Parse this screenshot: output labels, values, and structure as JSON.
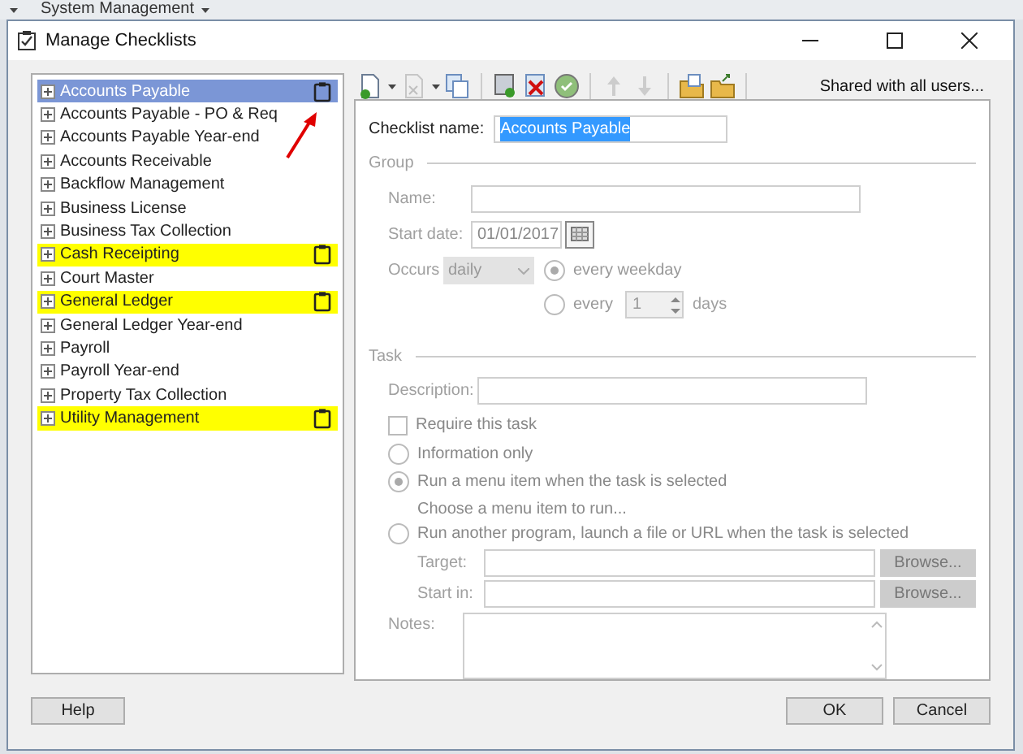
{
  "app_bar": {
    "title": "System Management"
  },
  "window": {
    "title": "Manage Checklists"
  },
  "tree": {
    "items": [
      {
        "label": "Accounts Payable",
        "selected": true,
        "highlighted": false,
        "has_checklist": true
      },
      {
        "label": "Accounts Payable - PO & Req",
        "selected": false,
        "highlighted": false,
        "has_checklist": false
      },
      {
        "label": "Accounts Payable Year-end",
        "selected": false,
        "highlighted": false,
        "has_checklist": false
      },
      {
        "label": "Accounts Receivable",
        "selected": false,
        "highlighted": false,
        "has_checklist": false
      },
      {
        "label": "Backflow Management",
        "selected": false,
        "highlighted": false,
        "has_checklist": false
      },
      {
        "label": "Business License",
        "selected": false,
        "highlighted": false,
        "has_checklist": false
      },
      {
        "label": "Business Tax Collection",
        "selected": false,
        "highlighted": false,
        "has_checklist": false
      },
      {
        "label": "Cash Receipting",
        "selected": false,
        "highlighted": true,
        "has_checklist": true
      },
      {
        "label": "Court Master",
        "selected": false,
        "highlighted": false,
        "has_checklist": false
      },
      {
        "label": "General Ledger",
        "selected": false,
        "highlighted": true,
        "has_checklist": true
      },
      {
        "label": "General Ledger Year-end",
        "selected": false,
        "highlighted": false,
        "has_checklist": false
      },
      {
        "label": "Payroll",
        "selected": false,
        "highlighted": false,
        "has_checklist": false
      },
      {
        "label": "Payroll Year-end",
        "selected": false,
        "highlighted": false,
        "has_checklist": false
      },
      {
        "label": "Property Tax Collection",
        "selected": false,
        "highlighted": false,
        "has_checklist": false
      },
      {
        "label": "Utility Management",
        "selected": false,
        "highlighted": true,
        "has_checklist": true
      }
    ]
  },
  "toolbar": {
    "shared_link": "Shared with all users..."
  },
  "checklist_name": {
    "label": "Checklist name:",
    "value": "Accounts Payable"
  },
  "group": {
    "title": "Group",
    "name_label": "Name:",
    "start_date_label": "Start date:",
    "start_date": "01/01/2017",
    "occurs_label": "Occurs",
    "occurs": "daily",
    "options": [
      {
        "label": "every weekday",
        "selected": true
      },
      {
        "label": "every",
        "selected": false,
        "value": "1",
        "unit": "days"
      }
    ]
  },
  "task": {
    "title": "Task",
    "description_label": "Description:",
    "require": {
      "label": "Require this task",
      "checked": false
    },
    "options": [
      {
        "label": "Information only",
        "selected": false
      },
      {
        "label": "Run a menu item when the task is selected",
        "selected": true,
        "hint": "Choose a menu item to run..."
      },
      {
        "label": "Run another program, launch a file or URL when the task is selected",
        "selected": false
      }
    ],
    "target_label": "Target:",
    "start_in_label": "Start in:",
    "browse": [
      "Browse...",
      "Browse..."
    ],
    "notes_label": "Notes:"
  },
  "buttons": {
    "help": "Help",
    "ok": "OK",
    "cancel": "Cancel"
  }
}
